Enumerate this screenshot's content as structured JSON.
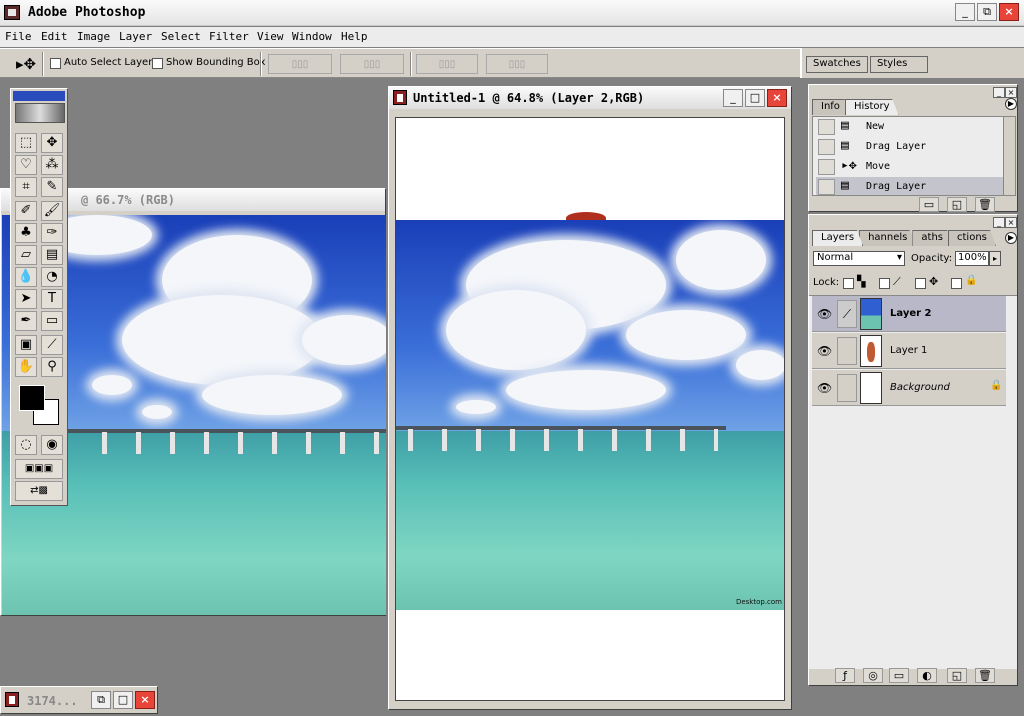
{
  "app": {
    "title": "Adobe Photoshop"
  },
  "window_controls": {
    "minimize": "_",
    "maximize": "□",
    "close": "×",
    "restore": "⧉"
  },
  "menu": [
    "File",
    "Edit",
    "Image",
    "Layer",
    "Select",
    "Filter",
    "View",
    "Window",
    "Help"
  ],
  "options_bar": {
    "auto_select_label": "Auto Select Layer",
    "show_bounding_label": "Show Bounding Box"
  },
  "palette_well": {
    "tabs": [
      "Swatches",
      "Styles"
    ]
  },
  "doc_back": {
    "title": "@ 66.7% (RGB)"
  },
  "doc_front": {
    "title": "Untitled-1 @ 64.8% (Layer 2,RGB)",
    "watermark": "Desktop.com"
  },
  "minimized_doc": {
    "title": "3174..."
  },
  "history_panel": {
    "tabs": [
      "Info",
      "History"
    ],
    "active_tab": "History",
    "items": [
      {
        "label": "New",
        "icon": "document-icon"
      },
      {
        "label": "Drag Layer",
        "icon": "document-icon"
      },
      {
        "label": "Move",
        "icon": "move-icon"
      },
      {
        "label": "Drag Layer",
        "icon": "document-icon"
      }
    ]
  },
  "layers_panel": {
    "tabs": [
      "Layers",
      "Channels",
      "Paths",
      "Actions"
    ],
    "tab_visible": [
      "Layers",
      "hannels",
      "aths",
      "ctions"
    ],
    "blend_mode": "Normal",
    "opacity_label": "Opacity:",
    "opacity_value": "100%",
    "lock_label": "Lock:",
    "layers": [
      {
        "name": "Layer 2",
        "selected": true,
        "visible": true
      },
      {
        "name": "Layer 1",
        "selected": false,
        "visible": true
      },
      {
        "name": "Background",
        "selected": false,
        "visible": true,
        "locked": true
      }
    ]
  },
  "colors": {
    "sky": "#1a3fb8",
    "sea": "#59c0b8",
    "chrome": "#d4d0c8",
    "close": "#e8453a"
  }
}
